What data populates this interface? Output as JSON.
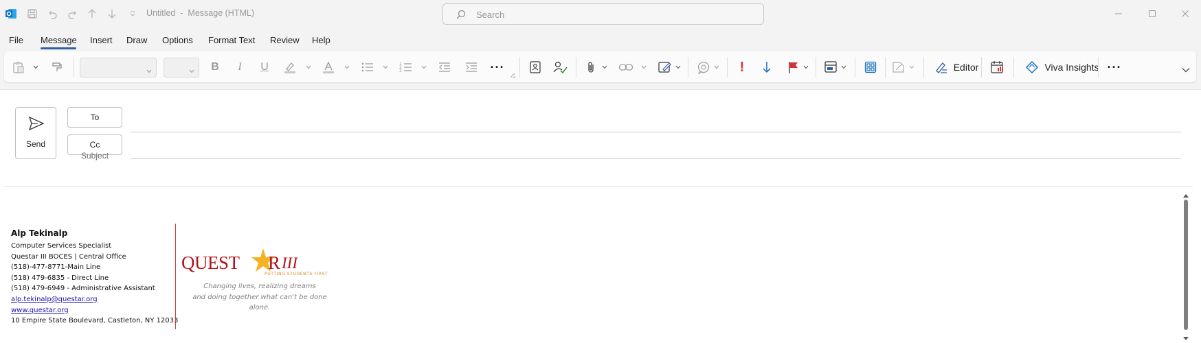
{
  "titlebar": {
    "title": "Untitled  -  Message (HTML)",
    "search_placeholder": "Search"
  },
  "menu": {
    "tabs": [
      "File",
      "Message",
      "Insert",
      "Draw",
      "Options",
      "Format Text",
      "Review",
      "Help"
    ],
    "active": "Message"
  },
  "ribbon": {
    "editor_label": "Editor",
    "viva_label": "Viva Insights",
    "accent_color": "#2f5f9e",
    "importance_color": "#d13438",
    "flag_color": "#d13438"
  },
  "compose": {
    "send_label": "Send",
    "to_label": "To",
    "cc_label": "Cc",
    "subject_label": "Subject"
  },
  "signature": {
    "name": "Alp Tekinalp",
    "title": "Computer Services Specialist",
    "org": "Questar III BOCES | Central Office",
    "phone_main": "(518)-477-8771-Main Line",
    "phone_direct": "(518) 479-6835 - Direct Line",
    "phone_admin": "(518) 479-6949 - Administrative Assistant",
    "email": "alp.tekinalp@questar.org",
    "website": "www.questar.org",
    "address": "10 Empire State Boulevard, Castleton, NY 12033",
    "logo_text": "QUESTAR III",
    "logo_tagline": "PUTTING STUDENTS FIRST",
    "tagline_1": "Changing lives, realizing dreams",
    "tagline_2": "and doing together what can't be done alone.",
    "divider_color": "#d33b3b"
  }
}
